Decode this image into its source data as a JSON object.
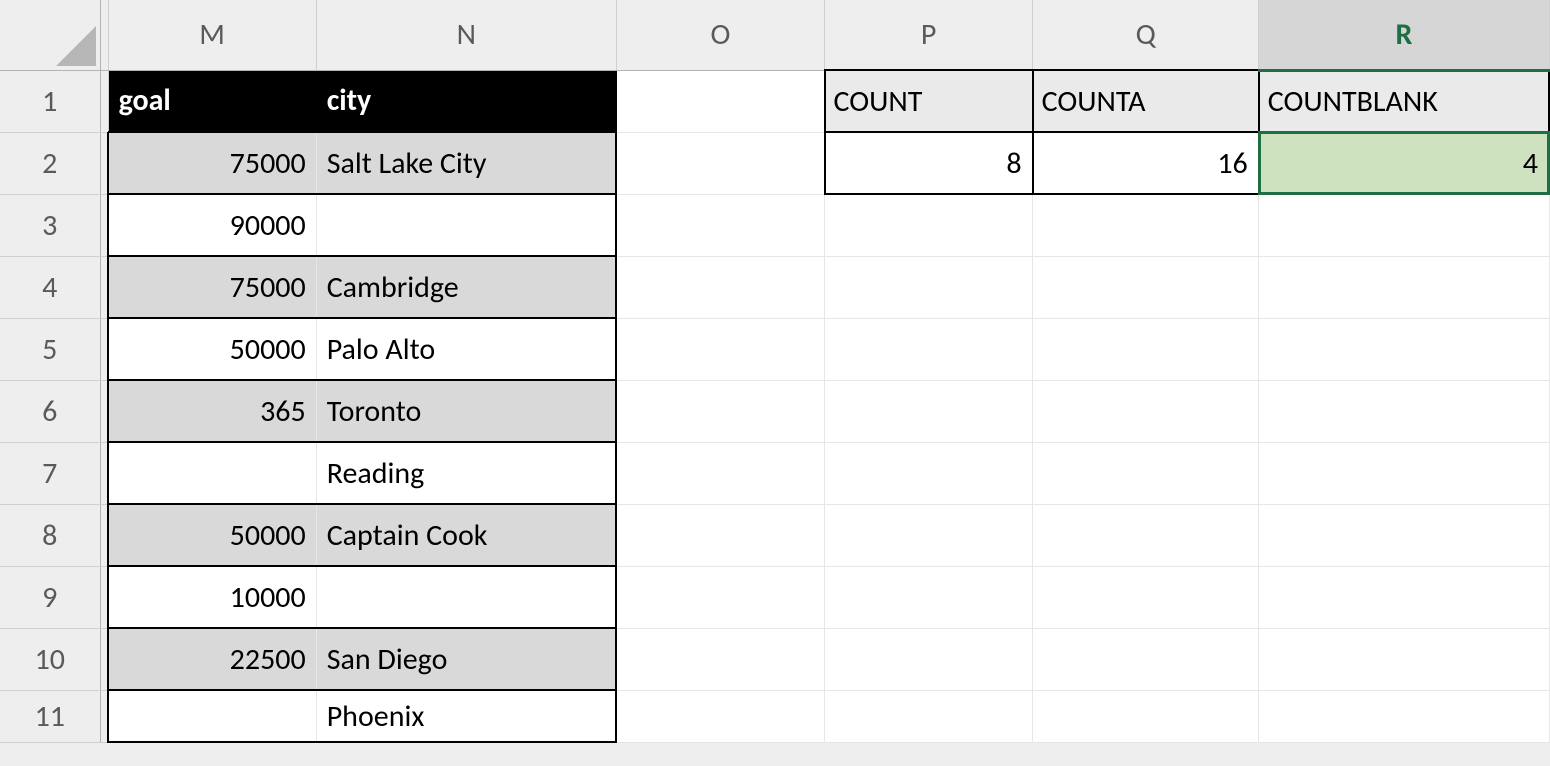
{
  "columns": {
    "M": "M",
    "N": "N",
    "O": "O",
    "P": "P",
    "Q": "Q",
    "R": "R"
  },
  "active_column": "R",
  "row_numbers": [
    "1",
    "2",
    "3",
    "4",
    "5",
    "6",
    "7",
    "8",
    "9",
    "10",
    "11"
  ],
  "table": {
    "headers": {
      "goal": "goal",
      "city": "city"
    },
    "rows": [
      {
        "goal": "75000",
        "city": "Salt Lake City"
      },
      {
        "goal": "90000",
        "city": ""
      },
      {
        "goal": "75000",
        "city": "Cambridge"
      },
      {
        "goal": "50000",
        "city": "Palo Alto"
      },
      {
        "goal": "365",
        "city": "Toronto"
      },
      {
        "goal": "",
        "city": "Reading"
      },
      {
        "goal": "50000",
        "city": "Captain Cook"
      },
      {
        "goal": "10000",
        "city": ""
      },
      {
        "goal": "22500",
        "city": "San Diego"
      },
      {
        "goal": "",
        "city": "Phoenix"
      }
    ]
  },
  "summary": {
    "labels": {
      "count": "COUNT",
      "counta": "COUNTA",
      "countblank": "COUNTBLANK"
    },
    "values": {
      "count": "8",
      "counta": "16",
      "countblank": "4"
    }
  },
  "selected_cell": "R2"
}
